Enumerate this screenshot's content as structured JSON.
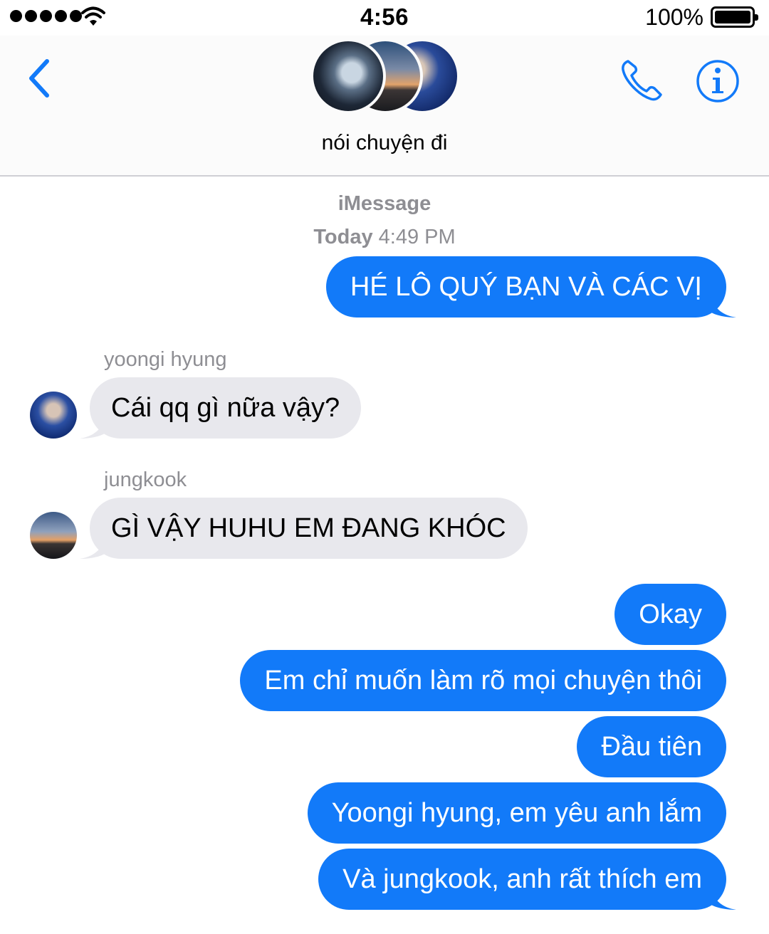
{
  "status_bar": {
    "time": "4:56",
    "battery_percent": "100%",
    "signal_icon": "signal-dots-icon",
    "wifi_icon": "wifi-icon",
    "battery_icon": "battery-icon"
  },
  "header": {
    "back_icon": "chevron-left-icon",
    "group_name": "nói chuyện đi",
    "call_icon": "phone-icon",
    "info_icon": "info-icon",
    "accent_color": "#127af9"
  },
  "thread": {
    "service": "iMessage",
    "day": "Today",
    "time": "4:49 PM",
    "messages": [
      {
        "from": "me",
        "text": "HÉ LÔ QUÝ BẠN VÀ CÁC VỊ"
      },
      {
        "from": "yoongi hyung",
        "text": "Cái qq gì nữa vậy?"
      },
      {
        "from": "jungkook",
        "text": "GÌ VẬY HUHU EM ĐANG KHÓC"
      },
      {
        "from": "me",
        "text": "Okay"
      },
      {
        "from": "me",
        "text": "Em chỉ muốn làm rõ mọi chuyện thôi"
      },
      {
        "from": "me",
        "text": "Đầu tiên"
      },
      {
        "from": "me",
        "text": "Yoongi hyung, em yêu anh lắm"
      },
      {
        "from": "me",
        "text": "Và jungkook, anh rất thích em"
      }
    ],
    "colors": {
      "outgoing": "#127af9",
      "incoming": "#e8e8ed",
      "meta": "#8e8e93"
    }
  }
}
